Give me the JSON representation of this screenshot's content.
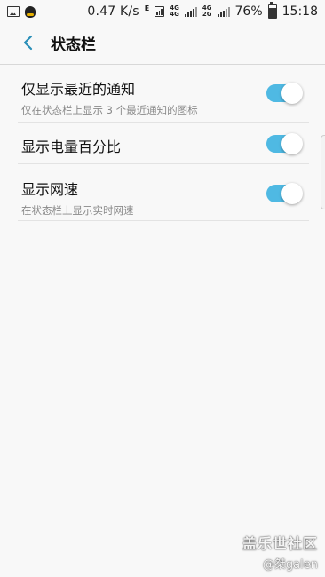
{
  "status_bar": {
    "network_speed": "0.47 K/s",
    "network_type_1": "E",
    "net_4g_top": "4G",
    "net_4g_bottom": "4G",
    "net_2g": "2G",
    "battery_percent": "76%",
    "battery_level": 0.76,
    "time": "15:18"
  },
  "header": {
    "title": "状态栏"
  },
  "settings": [
    {
      "title": "仅显示最近的通知",
      "subtitle": "仅在状态栏上显示 3 个最近通知的图标",
      "enabled": true
    },
    {
      "title": "显示电量百分比",
      "subtitle": "",
      "enabled": true
    },
    {
      "title": "显示网速",
      "subtitle": "在状态栏上显示实时网速",
      "enabled": true
    }
  ],
  "watermark": {
    "line1": "盖乐世社区",
    "line2": "@桀galen"
  },
  "colors": {
    "toggle_on": "#4fb9e3",
    "back_arrow": "#2a8fb8"
  }
}
